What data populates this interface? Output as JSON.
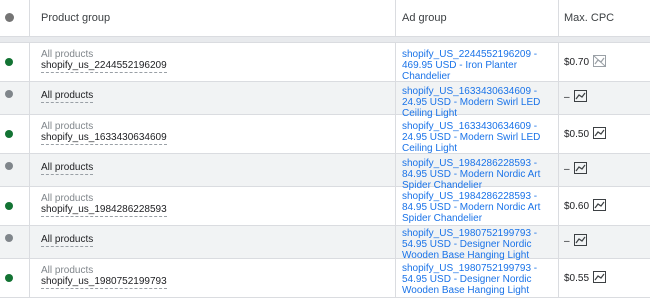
{
  "header": {
    "product_group": "Product group",
    "ad_group": "Ad group",
    "max_cpc": "Max. CPC"
  },
  "rows": [
    {
      "status": "green",
      "pg_sub": "All products",
      "pg_main": "shopify_us_2244552196209",
      "ad_group": "shopify_US_2244552196209 - 469.95 USD - Iron Planter Chandelier",
      "cpc": "$0.70",
      "icon": "trend-chart-disabled-icon"
    },
    {
      "status": "grey",
      "pg_sub": "",
      "pg_main": "All products",
      "ad_group": "shopify_US_1633430634609 - 24.95 USD - Modern Swirl LED Ceiling Light",
      "cpc": "–",
      "icon": "trend-chart-icon"
    },
    {
      "status": "green",
      "pg_sub": "All products",
      "pg_main": "shopify_us_1633430634609",
      "ad_group": "shopify_US_1633430634609 - 24.95 USD - Modern Swirl LED Ceiling Light",
      "cpc": "$0.50",
      "icon": "trend-chart-icon"
    },
    {
      "status": "grey",
      "pg_sub": "",
      "pg_main": "All products",
      "ad_group": "shopify_US_1984286228593 - 84.95 USD - Modern Nordic Art Spider Chandelier",
      "cpc": "–",
      "icon": "trend-chart-icon"
    },
    {
      "status": "green",
      "pg_sub": "All products",
      "pg_main": "shopify_us_1984286228593",
      "ad_group": "shopify_US_1984286228593 - 84.95 USD - Modern Nordic Art Spider Chandelier",
      "cpc": "$0.60",
      "icon": "trend-chart-icon"
    },
    {
      "status": "grey",
      "pg_sub": "",
      "pg_main": "All products",
      "ad_group": "shopify_US_1980752199793 - 54.95 USD - Designer Nordic Wooden Base Hanging Light",
      "cpc": "–",
      "icon": "trend-chart-icon"
    },
    {
      "status": "green",
      "pg_sub": "All products",
      "pg_main": "shopify_us_1980752199793",
      "ad_group": "shopify_US_1980752199793 - 54.95 USD - Designer Nordic Wooden Base Hanging Light",
      "cpc": "$0.55",
      "icon": "trend-chart-icon"
    }
  ]
}
